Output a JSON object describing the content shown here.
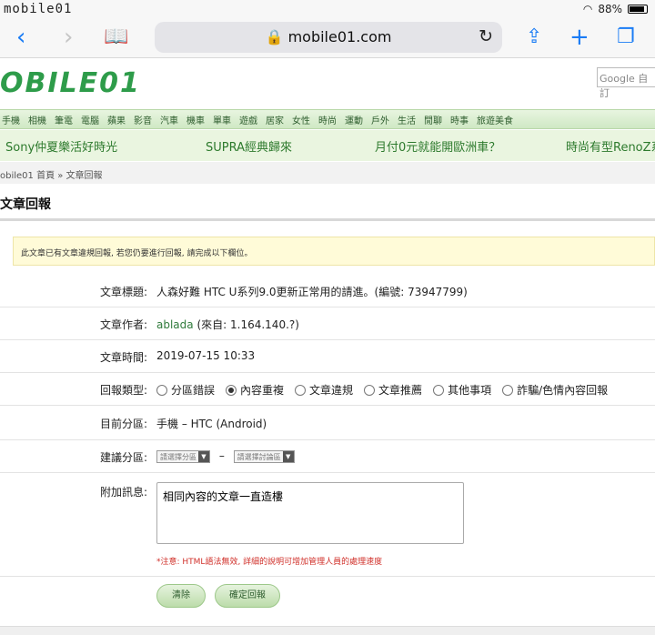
{
  "status": {
    "carrier": "mobile01",
    "battery": "88%"
  },
  "browser": {
    "url": "mobile01.com"
  },
  "site": {
    "logo": "OBILE01",
    "search_placeholder": "Google 自訂"
  },
  "categories": [
    "手機",
    "相機",
    "筆電",
    "電腦",
    "蘋果",
    "影音",
    "汽車",
    "機車",
    "單車",
    "遊戲",
    "居家",
    "女性",
    "時尚",
    "運動",
    "戶外",
    "生活",
    "閒聊",
    "時事",
    "旅遊美食"
  ],
  "promos": [
    "Sony仲夏樂活好時光",
    "SUPRA經典歸來",
    "月付0元就能開歐洲車？",
    "時尚有型RenoZ系"
  ],
  "breadcrumb": "obile01 首頁 » 文章回報",
  "page_title": "文章回報",
  "notice": "此文章已有文章違規回報, 若您仍要進行回報, 請完成以下欄位。",
  "form": {
    "title_label": "文章標題:",
    "title_value": "人森好難 HTC U系列9.0更新正常用的請進。(編號: 73947799)",
    "author_label": "文章作者:",
    "author_name": "ablada",
    "author_from": "(來自: 1.164.140.?)",
    "time_label": "文章時間:",
    "time_value": "2019-07-15 10:33",
    "type_label": "回報類型:",
    "types": [
      "分區錯誤",
      "內容重複",
      "文章違規",
      "文章推薦",
      "其他事項",
      "詐騙/色情內容回報"
    ],
    "selected_type": "內容重複",
    "forum_label": "目前分區:",
    "forum_value": "手機 – HTC (Android)",
    "suggest_label": "建議分區:",
    "suggest_select1": "請選擇分區",
    "suggest_dash": "–",
    "suggest_select2": "請選擇討論區",
    "message_label": "附加訊息:",
    "message_value": "相同內容的文章一直造樓",
    "warning": "*注意: HTML語法無效, 詳細的說明可增加管理人員的處理速度",
    "clear_button": "清除",
    "submit_button": "確定回報"
  }
}
